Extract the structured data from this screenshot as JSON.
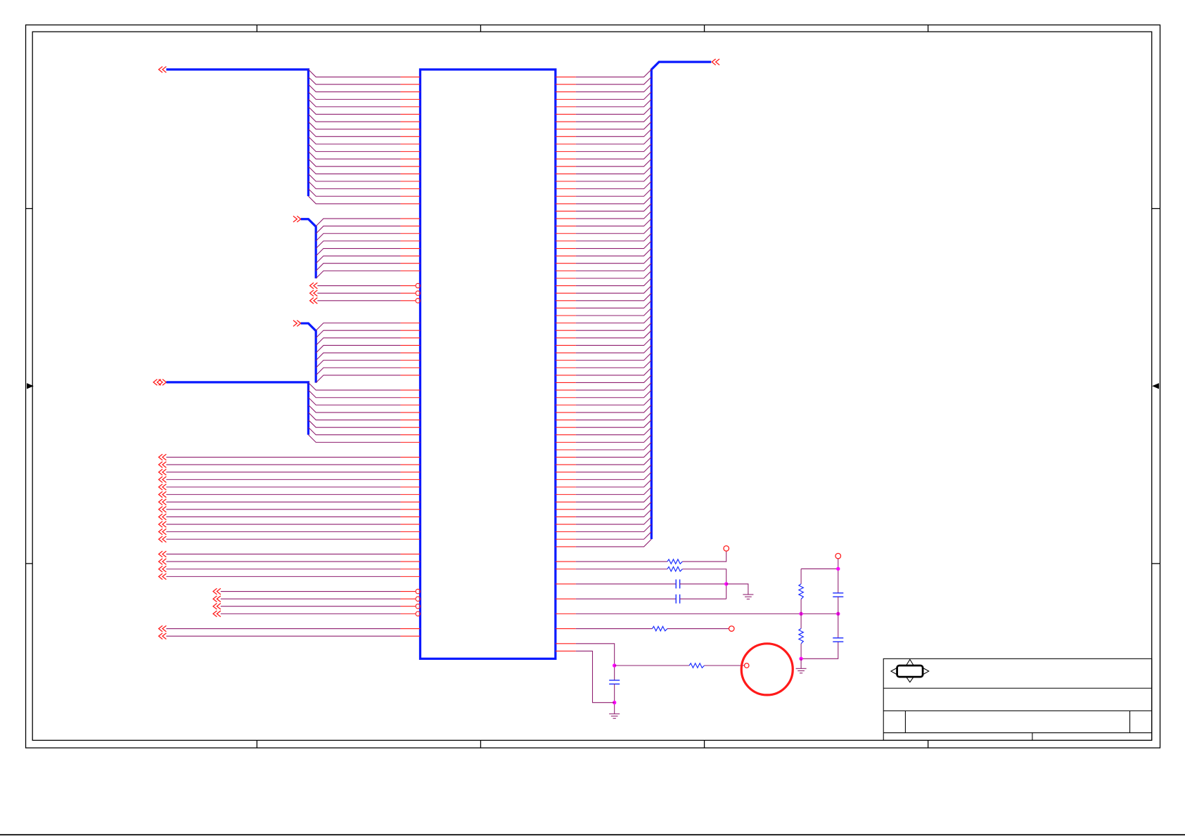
{
  "colors": {
    "wire": "#8f1f6f",
    "pin": "#ff1a1a",
    "bus": "#0a1aff",
    "part_outline": "#0a1aff",
    "passive": "#1a2aff",
    "junction": "#ff00ff",
    "connector": "#ff1a1a",
    "frame": "#000000",
    "background": "#ffffff"
  }
}
